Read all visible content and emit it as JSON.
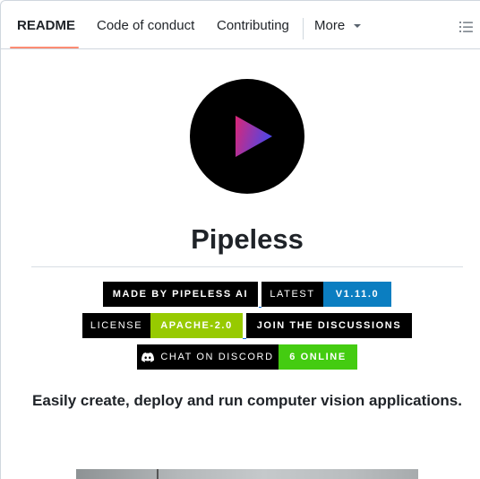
{
  "tabs": [
    {
      "label": "README",
      "active": true
    },
    {
      "label": "Code of conduct",
      "active": false
    },
    {
      "label": "Contributing",
      "active": false
    },
    {
      "label": "More",
      "active": false
    }
  ],
  "toc_icon": "list-unordered-icon",
  "logo": {
    "icon": "play-icon",
    "colors": [
      "#db2777",
      "#4f46e5"
    ]
  },
  "title": "Pipeless",
  "badges": {
    "made_by": {
      "label": "MADE BY PIPELESS AI",
      "color": "#000000"
    },
    "latest": {
      "label": "LATEST",
      "value": "V1.11.0",
      "label_color": "#000000",
      "value_color": "#0b7ec1"
    },
    "license": {
      "label": "LICENSE",
      "value": "APACHE-2.0",
      "label_color": "#000000",
      "value_color": "#97ca00"
    },
    "discussions": {
      "label": "JOIN THE DISCUSSIONS",
      "color": "#000000"
    },
    "discord": {
      "label": "CHAT ON DISCORD",
      "value": "6 ONLINE",
      "icon": "discord-icon",
      "label_color": "#000000",
      "value_color": "#44cc11"
    }
  },
  "tagline": "Easily create, deploy and run computer vision applications."
}
